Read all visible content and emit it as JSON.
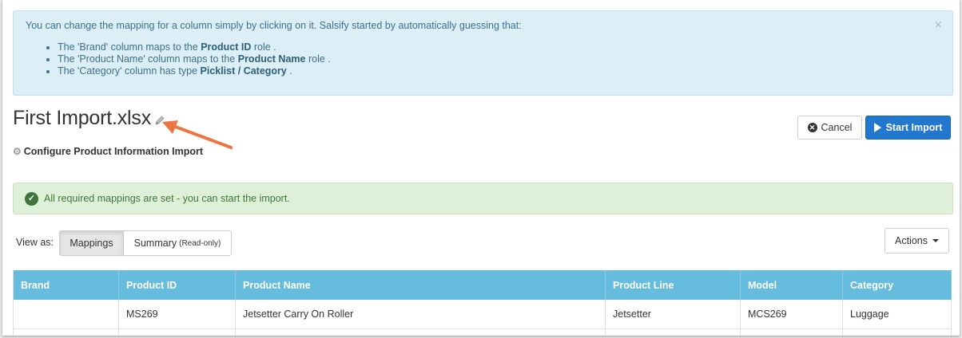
{
  "info": {
    "intro": "You can change the mapping for a column simply by clicking on it. Salsify started by automatically guessing that:",
    "items": [
      {
        "pre": "The '",
        "col": "Brand",
        "mid": "' column maps to the ",
        "strong": "Product ID",
        "post": " role ."
      },
      {
        "pre": "The '",
        "col": "Product Name",
        "mid": "' column maps to the ",
        "strong": "Product Name",
        "post": " role ."
      },
      {
        "pre": "The '",
        "col": "Category",
        "mid": "' column has type ",
        "strong": "Picklist / Category",
        "post": " ."
      }
    ],
    "close": "×"
  },
  "header": {
    "file_title": "First Import.xlsx",
    "subtitle": "Configure Product Information Import",
    "cancel_label": "Cancel",
    "start_label": "Start Import"
  },
  "success": {
    "message": "All required mappings are set - you can start the import."
  },
  "view": {
    "label": "View as:",
    "mappings": "Mappings",
    "summary": "Summary",
    "summary_note": "(Read-only)",
    "actions": "Actions"
  },
  "table": {
    "columns": [
      "Brand",
      "Product ID",
      "Product Name",
      "Product Line",
      "Model",
      "Category"
    ],
    "rows": [
      [
        "",
        "MS269",
        "Jetsetter Carry On Roller",
        "Jetsetter",
        "MCS269",
        "Luggage"
      ]
    ]
  },
  "colors": {
    "info_bg": "#dceff7",
    "success_bg": "#dff0d8",
    "primary": "#2278cf",
    "table_header": "#66bcdd"
  },
  "icons": [
    "close-icon",
    "pencil-icon",
    "gear-icon",
    "cancel-circle-icon",
    "play-icon",
    "check-circle-icon",
    "caret-down-icon"
  ]
}
